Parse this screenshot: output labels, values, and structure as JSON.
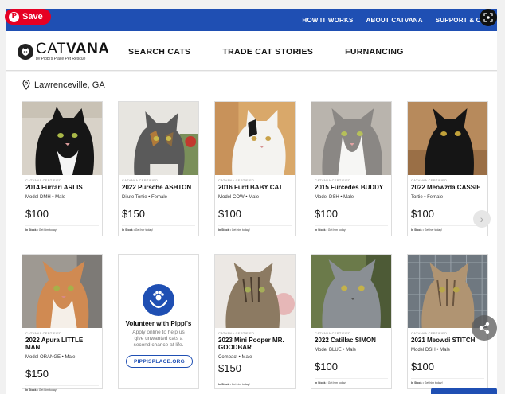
{
  "pinterest": {
    "save_label": "Save"
  },
  "topnav": {
    "items": [
      "HOW IT WORKS",
      "ABOUT CATVANA",
      "SUPPORT & CON"
    ]
  },
  "logo": {
    "brand_light": "CAT",
    "brand_bold": "VANA",
    "tagline": "by Pippi's Place Pet Rescue"
  },
  "mainnav": {
    "items": [
      "SEARCH CATS",
      "TRADE CAT STORIES",
      "FURNANCING"
    ]
  },
  "location": "Lawrenceville, GA",
  "cards": [
    {
      "tag": "CATVANA CERTIFIED",
      "name": "2014 Furrari ARLIS",
      "model": "Model DMH • Male",
      "price": "$100",
      "stock_bold": "In Stock",
      "stock_rest": " • Get him today!"
    },
    {
      "tag": "CATVANA CERTIFIED",
      "name": "2022 Pursche ASHTON",
      "model": "Dilute Tortie • Female",
      "price": "$150",
      "stock_bold": "In Stock",
      "stock_rest": " • Get her today!"
    },
    {
      "tag": "CATVANA CERTIFIED",
      "name": "2016 Furd BABY CAT",
      "model": "Model COW • Male",
      "price": "$100",
      "stock_bold": "In Stock",
      "stock_rest": " • Get him today!"
    },
    {
      "tag": "CATVANA CERTIFIED",
      "name": "2015 Furcedes BUDDY",
      "model": "Model DSH • Male",
      "price": "$100",
      "stock_bold": "In Stock",
      "stock_rest": " • Get him today!"
    },
    {
      "tag": "CATVANA CERTIFIED",
      "name": "2022 Meowzda CASSIE",
      "model": "Tortie • Female",
      "price": "$100",
      "stock_bold": "In Stock",
      "stock_rest": " • Get her today!"
    },
    {
      "tag": "CATVANA CERTIFIED",
      "name": "2022 Apura LITTLE MAN",
      "model": "Model ORANGE • Male",
      "price": "$150",
      "stock_bold": "In Stock",
      "stock_rest": " • Get him today!"
    },
    {
      "tag": "CATVANA CERTIFIED",
      "name": "2023 Mini Pooper MR. GOODBAR",
      "model": "Compact • Male",
      "price": "$150",
      "stock_bold": "In Stock",
      "stock_rest": " • Get him today!"
    },
    {
      "tag": "CATVANA CERTIFIED",
      "name": "2022 Catillac SIMON",
      "model": "Model BLUE • Male",
      "price": "$100",
      "stock_bold": "In Stock",
      "stock_rest": " • Get him today!"
    },
    {
      "tag": "CATVANA CERTIFIED",
      "name": "2021 Meowdi STITCH",
      "model": "Model DSH • Male",
      "price": "$100",
      "stock_bold": "In Stock",
      "stock_rest": " • Get him today!"
    }
  ],
  "promo": {
    "title": "Volunteer with Pippi's",
    "text": "Apply online to help us give unwanted cats a second chance at life.",
    "button": "PIPPISPLACE.ORG"
  },
  "colors": {
    "brand_blue": "#1f4fb3",
    "pinterest_red": "#e60023"
  }
}
